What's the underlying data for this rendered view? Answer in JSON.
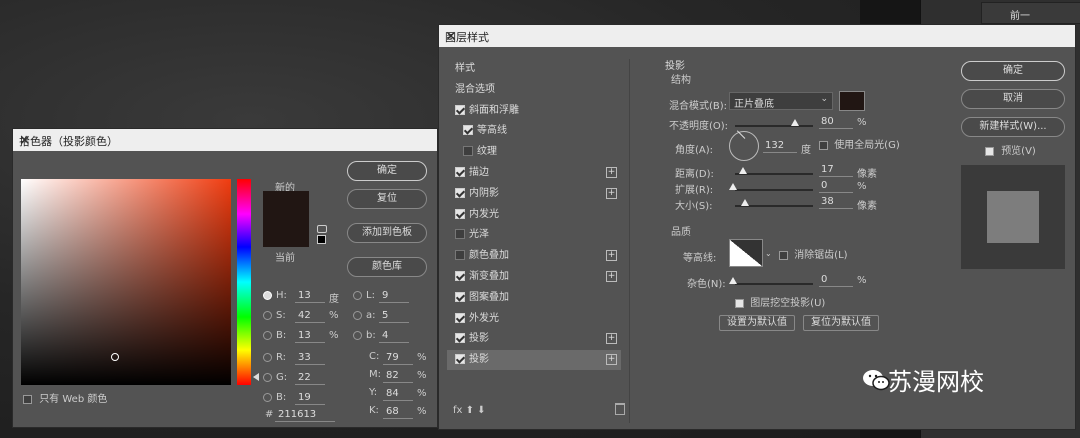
{
  "right_panel": {
    "tab_label": "前一"
  },
  "color_picker": {
    "title": "拾色器（投影颜色）",
    "new_label": "新的",
    "current_label": "当前",
    "ok": "确定",
    "reset": "复位",
    "add_swatch": "添加到色板",
    "library": "颜色库",
    "color": "#211613",
    "hsb": [
      {
        "label": "H:",
        "value": "13",
        "unit": "度"
      },
      {
        "label": "S:",
        "value": "42",
        "unit": "%"
      },
      {
        "label": "B:",
        "value": "13",
        "unit": "%"
      }
    ],
    "rgb": [
      {
        "label": "R:",
        "value": "33"
      },
      {
        "label": "G:",
        "value": "22"
      },
      {
        "label": "B:",
        "value": "19"
      }
    ],
    "lab": [
      {
        "label": "L:",
        "value": "9"
      },
      {
        "label": "a:",
        "value": "5"
      },
      {
        "label": "b:",
        "value": "4"
      }
    ],
    "cmyk": [
      {
        "label": "C:",
        "value": "79",
        "unit": "%"
      },
      {
        "label": "M:",
        "value": "82",
        "unit": "%"
      },
      {
        "label": "Y:",
        "value": "84",
        "unit": "%"
      },
      {
        "label": "K:",
        "value": "68",
        "unit": "%"
      }
    ],
    "hex_label": "#",
    "hex": "211613",
    "web_only": "只有 Web 颜色"
  },
  "layer_style": {
    "title": "图层样式",
    "list": [
      {
        "label": "样式",
        "check": "none",
        "plus": false
      },
      {
        "label": "混合选项",
        "check": "none",
        "plus": false
      },
      {
        "label": "斜面和浮雕",
        "check": "on",
        "plus": false
      },
      {
        "label": "等高线",
        "check": "on",
        "plus": false,
        "indent": true
      },
      {
        "label": "纹理",
        "check": "off",
        "plus": false,
        "indent": true
      },
      {
        "label": "描边",
        "check": "on",
        "plus": true
      },
      {
        "label": "内阴影",
        "check": "on",
        "plus": true
      },
      {
        "label": "内发光",
        "check": "on",
        "plus": false
      },
      {
        "label": "光泽",
        "check": "off",
        "plus": false
      },
      {
        "label": "颜色叠加",
        "check": "off",
        "plus": true
      },
      {
        "label": "渐变叠加",
        "check": "on",
        "plus": true
      },
      {
        "label": "图案叠加",
        "check": "on",
        "plus": false
      },
      {
        "label": "外发光",
        "check": "on",
        "plus": false
      },
      {
        "label": "投影",
        "check": "on",
        "plus": true
      },
      {
        "label": "投影",
        "check": "on",
        "plus": true,
        "selected": true
      }
    ],
    "bottom_icons": "fx  ⬆  ⬇",
    "section": "投影",
    "structure": "结构",
    "blend_mode_label": "混合模式(B):",
    "blend_mode": "正片叠底",
    "shadow_color": "#211613",
    "opacity_label": "不透明度(O):",
    "opacity": "80",
    "opacity_unit": "%",
    "angle_label": "角度(A):",
    "angle": "132",
    "angle_unit": "度",
    "global_light": "使用全局光(G)",
    "distance_label": "距离(D):",
    "distance": "17",
    "distance_unit": "像素",
    "spread_label": "扩展(R):",
    "spread": "0",
    "spread_unit": "%",
    "size_label": "大小(S):",
    "size": "38",
    "size_unit": "像素",
    "quality": "品质",
    "contour_label": "等高线:",
    "anti_alias": "消除锯齿(L)",
    "noise_label": "杂色(N):",
    "noise": "0",
    "noise_unit": "%",
    "knockout": "图层挖空投影(U)",
    "set_default": "设置为默认值",
    "reset_default": "复位为默认值",
    "ok": "确定",
    "cancel": "取消",
    "new_style": "新建样式(W)...",
    "preview": "预览(V)"
  },
  "watermark": "苏漫网校"
}
